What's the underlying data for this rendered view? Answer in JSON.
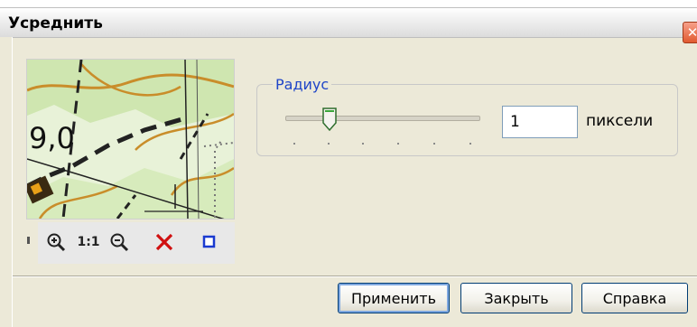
{
  "window": {
    "title": "Усреднить"
  },
  "preview": {
    "label": "9,0"
  },
  "toolbar": {
    "zoom_in_icon": "zoom-in-icon",
    "actual_size_label": "1:1",
    "zoom_out_icon": "zoom-out-icon",
    "delete_icon": "red-x-icon",
    "frame_icon": "blue-square-icon"
  },
  "radius": {
    "legend": "Радиус",
    "value": "1",
    "unit": "пиксели",
    "slider_fraction": 0.2
  },
  "buttons": {
    "apply": "Применить",
    "close": "Закрыть",
    "help": "Справка"
  },
  "colors": {
    "legend": "#1f45c8",
    "close": "#e15a30",
    "delete_icon": "#d01010",
    "frame_icon": "#1a3ad0"
  }
}
